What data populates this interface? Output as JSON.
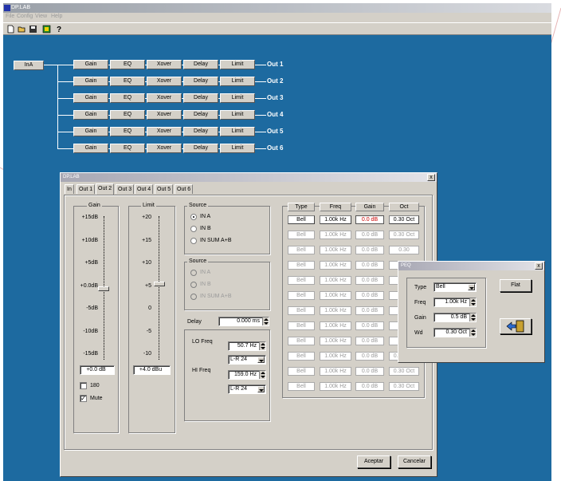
{
  "app": {
    "title": "DP.LAB"
  },
  "menu": [
    "File",
    "Config",
    "View",
    "Help"
  ],
  "toolbar": [
    "new-icon",
    "open-icon",
    "save-icon",
    "device-icon",
    "help-icon"
  ],
  "chain": {
    "input_label": "InA",
    "blocks": [
      "Gain",
      "EQ",
      "Xover",
      "Delay",
      "Limit"
    ],
    "outputs": [
      "Out 1",
      "Out 2",
      "Out 3",
      "Out 4",
      "Out 5",
      "Out 6"
    ]
  },
  "dialog": {
    "title": "DP.LAB",
    "close": "x",
    "tabs": [
      "In",
      "Out 1",
      "Out 2",
      "Out 3",
      "Out 4",
      "Out 5",
      "Out 6"
    ],
    "active_tab": "Out 2",
    "gain": {
      "title": "Gain",
      "ticks": [
        "+15dB",
        "+10dB",
        "+5dB",
        "+0.0dB",
        "-5dB",
        "-10dB",
        "-15dB"
      ],
      "value": "+0.0 dB",
      "invert_label": "180",
      "mute_label": "Mute",
      "mute_check": "✓",
      "level": 0.5
    },
    "limit": {
      "title": "Limit",
      "ticks": [
        "+20",
        "+15",
        "+10",
        "+5",
        "0",
        "-5",
        "-10"
      ],
      "value": "+4.0 dBu",
      "level": 0.47
    },
    "source1": {
      "title": "Source",
      "options": [
        "IN A",
        "IN B",
        "IN SUM A+B"
      ],
      "selected": "IN A"
    },
    "source2": {
      "title": "Source",
      "options": [
        "IN A",
        "IN B",
        "IN SUM A+B"
      ]
    },
    "delay": {
      "label": "Delay",
      "value": "0.000 ms"
    },
    "lo_freq": {
      "label": "LO Freq",
      "value": "50.7 Hz",
      "type": "L-R 24"
    },
    "hi_freq": {
      "label": "HI Freq",
      "value": "159.0 Hz",
      "type": "L-R 24"
    },
    "eq": {
      "headers": [
        "Type",
        "Freq",
        "Gain",
        "Oct"
      ],
      "rows": [
        [
          "Bell",
          "1.00k Hz",
          "0.0 dB",
          "0.30 Oct"
        ],
        [
          "Bell",
          "1.00k Hz",
          "0.0 dB",
          "0.30 Oct"
        ],
        [
          "Bell",
          "1.00k Hz",
          "0.0 dB",
          "0.30"
        ],
        [
          "Bell",
          "1.00k Hz",
          "0.0 dB",
          "0.30"
        ],
        [
          "Bell",
          "1.00k Hz",
          "0.0 dB",
          "0.30"
        ],
        [
          "Bell",
          "1.00k Hz",
          "0.0 dB",
          "0.30"
        ],
        [
          "Bell",
          "1.00k Hz",
          "0.0 dB",
          "0.30"
        ],
        [
          "Bell",
          "1.00k Hz",
          "0.0 dB",
          "0.30"
        ],
        [
          "Bell",
          "1.00k Hz",
          "0.0 dB",
          "0.30"
        ],
        [
          "Bell",
          "1.00k Hz",
          "0.0 dB",
          "0.30 Oct"
        ],
        [
          "Bell",
          "1.00k Hz",
          "0.0 dB",
          "0.30 Oct"
        ],
        [
          "Bell",
          "1.00k Hz",
          "0.0 dB",
          "0.30 Oct"
        ]
      ]
    },
    "ok_label": "Aceptar",
    "cancel_label": "Cancelar"
  },
  "peq": {
    "title": "PEQ",
    "close": "x",
    "type_label": "Type",
    "type_value": "Bell",
    "freq_label": "Freq",
    "freq_value": "1.00k Hz",
    "gain_label": "Gain",
    "gain_value": "0.5 dB",
    "wd_label": "Wd",
    "wd_value": "0.30 Oct",
    "flat_label": "Flat",
    "exit_icon": "exit-door-icon"
  },
  "colors": {
    "workspace": "#1d6aa0",
    "accent_red": "#c00000"
  }
}
